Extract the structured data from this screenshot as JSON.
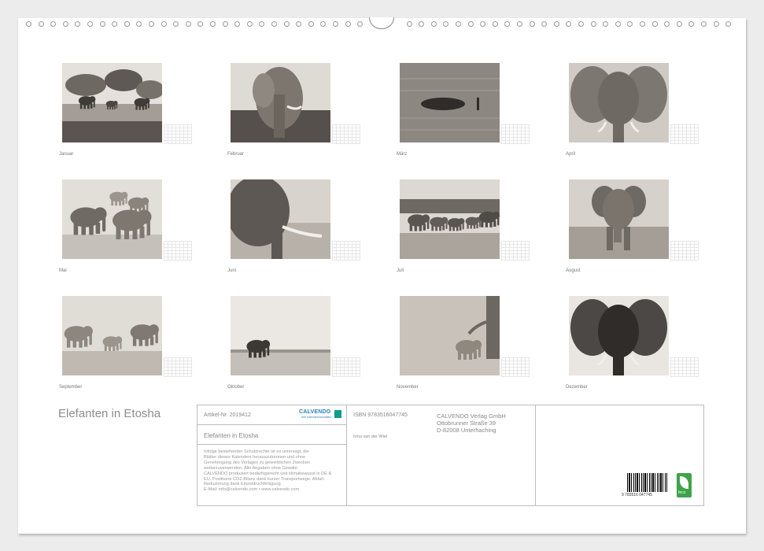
{
  "calendar_title": "Elefanten in Etosha",
  "months": [
    {
      "label": "Januar",
      "scene": "waterhole"
    },
    {
      "label": "Februar",
      "scene": "elephant-bush"
    },
    {
      "label": "März",
      "scene": "swimming"
    },
    {
      "label": "April",
      "scene": "elephant-face"
    },
    {
      "label": "Mai",
      "scene": "herd-closeup"
    },
    {
      "label": "Juni",
      "scene": "elephant-side"
    },
    {
      "label": "Juli",
      "scene": "line-walk"
    },
    {
      "label": "August",
      "scene": "approaching"
    },
    {
      "label": "September",
      "scene": "family-walk"
    },
    {
      "label": "Oktober",
      "scene": "lone-distance"
    },
    {
      "label": "November",
      "scene": "calf-adult"
    },
    {
      "label": "Dezember",
      "scene": "dark-face"
    }
  ],
  "info": {
    "article_no": "Artikel-Nr. 2019412",
    "isbn": "ISBN 9783516047745",
    "publisher_logo": "CALVENDO",
    "publisher_logo_sub": "Ihre Kalendermanufaktur",
    "publisher_lines": [
      "CALVENDO Verlag GmbH",
      "Ottobrunner Straße 39",
      "D-82008 Unterhaching"
    ],
    "product_title": "Elefanten in Etosha",
    "author": "Irma van der Wiel",
    "legal_lines": [
      "Infolge bestehender Schutzrechte ist es untersagt, die",
      "Blätter dieses Kalenders herauszutrennen und ohne",
      "Genehmigung des Verlages zu gewerblichen Zwecken",
      "weiterzuverwenden. Alle Angaben ohne Gewähr.",
      "CALVENDO produziert bedarfsgerecht und klimabewusst in DE &",
      "EU. Positivere CO2-Bilanz dank kurzer Transportwege. Abfall-",
      "Reduzierung dank Einzeldruckfertigung.",
      "E-Mail: info@calvendo.com • www.calvendo.com"
    ],
    "barcode_number": "9 783516 047745",
    "eco_label": "feco"
  },
  "colors": {
    "photo_light": "#d9d5cf",
    "photo_mid": "#9a948c",
    "photo_dark": "#4a4642",
    "accent": "#0f9b8e",
    "brand": "#2a7fb8"
  }
}
